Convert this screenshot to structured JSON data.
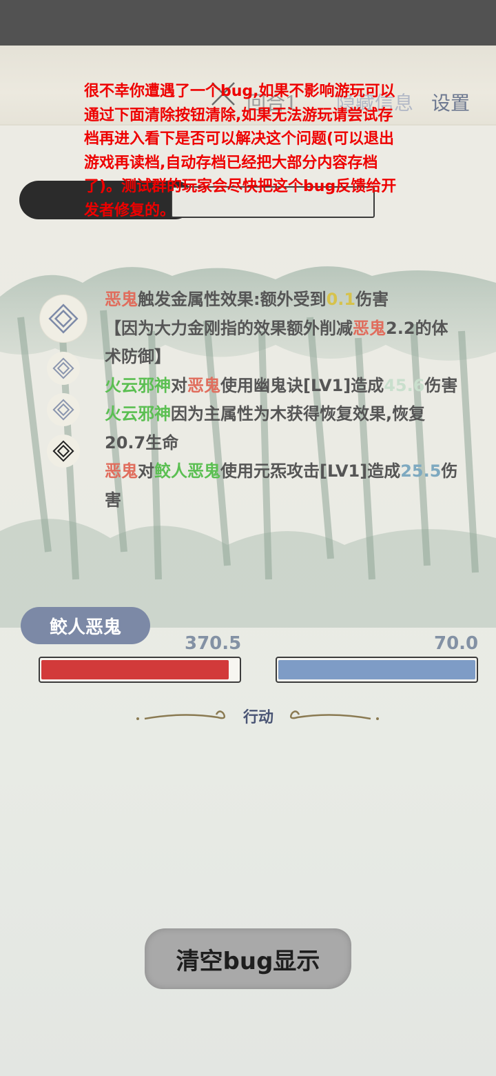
{
  "top_nav": {
    "level_label": "回合1",
    "hide_info": "隐藏信息",
    "settings": "设置"
  },
  "bug_notice": {
    "text": "很不幸你遭遇了一个bug,如果不影响游玩可以通过下面清除按钮清除,如果无法游玩请尝试存档再进入看下是否可以解决这个问题(可以退出游戏再读档,自动存档已经把大部分内容存档了)。测试群的玩家会尽快把这个bug反馈给开发者修复的。"
  },
  "battle_log": {
    "line1": {
      "actor": "恶鬼",
      "text": "触发金属性效果:额外受到",
      "value": "0.1",
      "suffix": "伤害"
    },
    "line2": {
      "pre": "【因为大力金刚指的效果额外削减",
      "target": "恶鬼",
      "post": "2.2的体术防御】"
    },
    "line3": {
      "actor": "火云邪神",
      "mid": "对",
      "target": "恶鬼",
      "text": "使用幽鬼诀[LV1]造成",
      "value": "45.6",
      "suffix": "伤害"
    },
    "line4": {
      "actor": "火云邪神",
      "text": "因为主属性为木获得恢复效果,恢复20.7生命"
    },
    "line5": {
      "actor": "恶鬼",
      "mid": "对",
      "target": "鲛人恶鬼",
      "text": "使用元炁攻击[LV1]造成",
      "value": "25.5",
      "suffix": "伤害"
    }
  },
  "enemy": {
    "name": "鲛人恶鬼",
    "hp": "370.5",
    "hp_fraction": 0.95,
    "mp": "70.0",
    "mp_fraction": 1.0
  },
  "action_label": "行动",
  "clear_button": "清空bug显示",
  "colors": {
    "enemy_name": "#e06d5d",
    "ally_name": "#5bbf52",
    "damage_value": "#d6c24c",
    "hp_bar": "#d23a3a",
    "mp_bar": "#7e9cc6",
    "bug_text": "#ee0000"
  }
}
